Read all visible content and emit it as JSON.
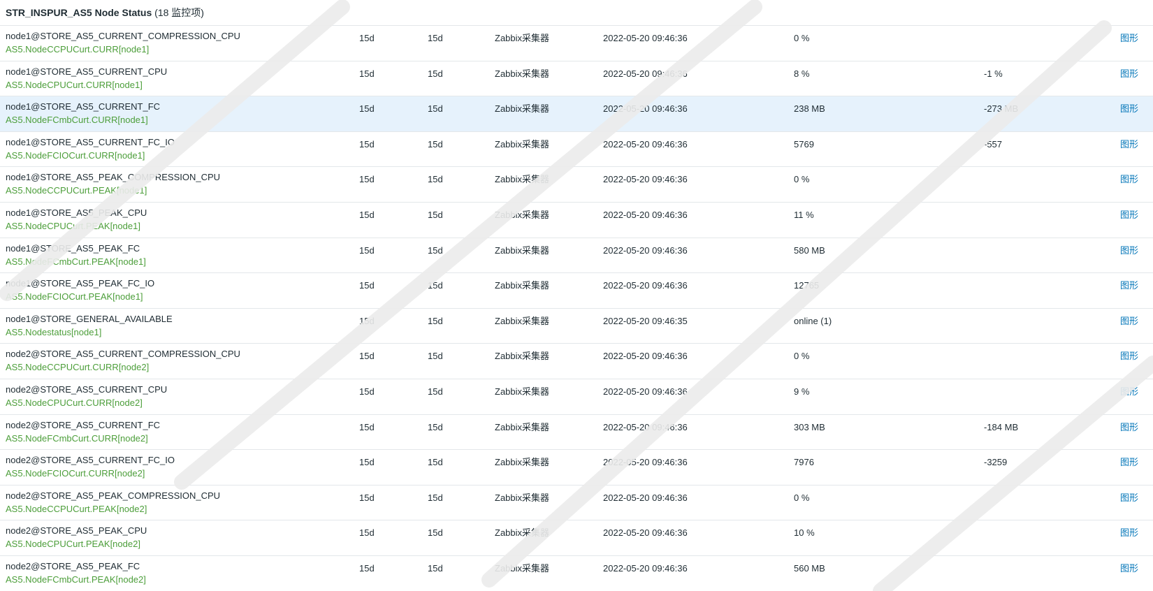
{
  "group": {
    "name": "STR_INSPUR_AS5 Node Status",
    "count": "(18 监控项)"
  },
  "rows": [
    {
      "name": "node1@STORE_AS5_CURRENT_COMPRESSION_CPU",
      "key": "AS5.NodeCCPUCurt.CURR[node1]",
      "interval": "15d",
      "history": "15d",
      "type": "Zabbix采集器",
      "time": "2022-05-20 09:46:36",
      "last": "0 %",
      "change": "",
      "graph": "图形"
    },
    {
      "name": "node1@STORE_AS5_CURRENT_CPU",
      "key": "AS5.NodeCPUCurt.CURR[node1]",
      "interval": "15d",
      "history": "15d",
      "type": "Zabbix采集器",
      "time": "2022-05-20 09:46:36",
      "last": "8 %",
      "change": "-1 %",
      "graph": "图形"
    },
    {
      "name": "node1@STORE_AS5_CURRENT_FC",
      "key": "AS5.NodeFCmbCurt.CURR[node1]",
      "interval": "15d",
      "history": "15d",
      "type": "Zabbix采集器",
      "time": "2022-05-20 09:46:36",
      "last": "238 MB",
      "change": "-273 MB",
      "graph": "图形"
    },
    {
      "name": "node1@STORE_AS5_CURRENT_FC_IO",
      "key": "AS5.NodeFCIOCurt.CURR[node1]",
      "interval": "15d",
      "history": "15d",
      "type": "Zabbix采集器",
      "time": "2022-05-20 09:46:36",
      "last": "5769",
      "change": "-557",
      "graph": "图形"
    },
    {
      "name": "node1@STORE_AS5_PEAK_COMPRESSION_CPU",
      "key": "AS5.NodeCCPUCurt.PEAK[node1]",
      "interval": "15d",
      "history": "15d",
      "type": "Zabbix采集器",
      "time": "2022-05-20 09:46:36",
      "last": "0 %",
      "change": "",
      "graph": "图形"
    },
    {
      "name": "node1@STORE_AS5_PEAK_CPU",
      "key": "AS5.NodeCPUCurt.PEAK[node1]",
      "interval": "15d",
      "history": "15d",
      "type": "Zabbix采集器",
      "time": "2022-05-20 09:46:36",
      "last": "11 %",
      "change": "",
      "graph": "图形"
    },
    {
      "name": "node1@STORE_AS5_PEAK_FC",
      "key": "AS5.NodeFCmbCurt.PEAK[node1]",
      "interval": "15d",
      "history": "15d",
      "type": "Zabbix采集器",
      "time": "2022-05-20 09:46:36",
      "last": "580 MB",
      "change": "",
      "graph": "图形"
    },
    {
      "name": "node1@STORE_AS5_PEAK_FC_IO",
      "key": "AS5.NodeFCIOCurt.PEAK[node1]",
      "interval": "15d",
      "history": "15d",
      "type": "Zabbix采集器",
      "time": "2022-05-20 09:46:36",
      "last": "12765",
      "change": "",
      "graph": "图形"
    },
    {
      "name": "node1@STORE_GENERAL_AVAILABLE",
      "key": "AS5.Nodestatus[node1]",
      "interval": "15d",
      "history": "15d",
      "type": "Zabbix采集器",
      "time": "2022-05-20 09:46:35",
      "last": "online (1)",
      "change": "",
      "graph": "图形"
    },
    {
      "name": "node2@STORE_AS5_CURRENT_COMPRESSION_CPU",
      "key": "AS5.NodeCCPUCurt.CURR[node2]",
      "interval": "15d",
      "history": "15d",
      "type": "Zabbix采集器",
      "time": "2022-05-20 09:46:36",
      "last": "0 %",
      "change": "",
      "graph": "图形"
    },
    {
      "name": "node2@STORE_AS5_CURRENT_CPU",
      "key": "AS5.NodeCPUCurt.CURR[node2]",
      "interval": "15d",
      "history": "15d",
      "type": "Zabbix采集器",
      "time": "2022-05-20 09:46:36",
      "last": "9 %",
      "change": "",
      "graph": "图形"
    },
    {
      "name": "node2@STORE_AS5_CURRENT_FC",
      "key": "AS5.NodeFCmbCurt.CURR[node2]",
      "interval": "15d",
      "history": "15d",
      "type": "Zabbix采集器",
      "time": "2022-05-20 09:46:36",
      "last": "303 MB",
      "change": "-184 MB",
      "graph": "图形"
    },
    {
      "name": "node2@STORE_AS5_CURRENT_FC_IO",
      "key": "AS5.NodeFCIOCurt.CURR[node2]",
      "interval": "15d",
      "history": "15d",
      "type": "Zabbix采集器",
      "time": "2022-05-20 09:46:36",
      "last": "7976",
      "change": "-3259",
      "graph": "图形"
    },
    {
      "name": "node2@STORE_AS5_PEAK_COMPRESSION_CPU",
      "key": "AS5.NodeCCPUCurt.PEAK[node2]",
      "interval": "15d",
      "history": "15d",
      "type": "Zabbix采集器",
      "time": "2022-05-20 09:46:36",
      "last": "0 %",
      "change": "",
      "graph": "图形"
    },
    {
      "name": "node2@STORE_AS5_PEAK_CPU",
      "key": "AS5.NodeCPUCurt.PEAK[node2]",
      "interval": "15d",
      "history": "15d",
      "type": "Zabbix采集器",
      "time": "2022-05-20 09:46:36",
      "last": "10 %",
      "change": "",
      "graph": "图形"
    },
    {
      "name": "node2@STORE_AS5_PEAK_FC",
      "key": "AS5.NodeFCmbCurt.PEAK[node2]",
      "interval": "15d",
      "history": "15d",
      "type": "Zabbix采集器",
      "time": "2022-05-20 09:46:36",
      "last": "560 MB",
      "change": "",
      "graph": "图形"
    }
  ],
  "highlight_row": 2,
  "colors": {
    "item_name": "#1f2c33",
    "item_key": "#4c9e3a",
    "graph_link": "#0275b8",
    "highlight": "#e6f2fc",
    "divider": "#e3e7ea"
  }
}
